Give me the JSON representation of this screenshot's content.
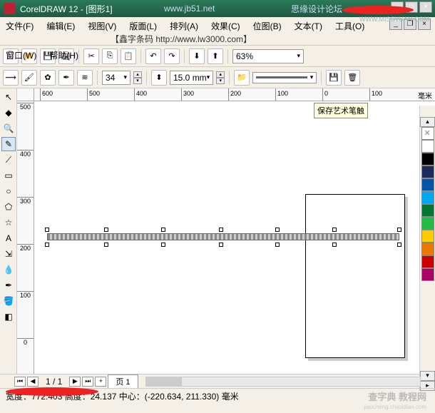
{
  "titlebar": {
    "app": "CorelDRAW 12",
    "doc": "[图形1]",
    "url": "www.jb51.net",
    "forum": "思缘设计论坛",
    "missyuan": "WWW.MISSYUAN.COM"
  },
  "menu": {
    "file": "文件(F)",
    "edit": "编辑(E)",
    "view": "视图(V)",
    "layout": "版面(L)",
    "arrange": "排列(A)",
    "effects": "效果(C)",
    "bitmap": "位图(B)",
    "text": "文本(T)",
    "tools": "工具(O)",
    "window": "窗口(W)",
    "help": "帮助(H)",
    "extra": "【鑫字条码 http://www.lw3000.com】"
  },
  "toolbar": {
    "zoom": "63%"
  },
  "propbar": {
    "preset": "34",
    "width": "15.0 mm"
  },
  "ruler_h": [
    "600",
    "500",
    "400",
    "300",
    "200",
    "100",
    "0",
    "100"
  ],
  "ruler_v": [
    "500",
    "400",
    "300",
    "200",
    "100",
    "0"
  ],
  "unit": "毫米",
  "tooltip": "保存艺术笔触",
  "page_nav": {
    "counter": "1 / 1",
    "tab": "页 1"
  },
  "status": {
    "dims": "宽度：772.403 高度：24.137 中心：(-220.634, 211.330) 毫米"
  },
  "palette_colors": [
    "#ffffff",
    "#000000",
    "#1a2a5a",
    "#0055aa",
    "#00aaee",
    "#007733",
    "#22bb44",
    "#ffcc00",
    "#ee7700",
    "#cc0000",
    "#aa0066"
  ],
  "watermark": {
    "main": "查字典   教程网",
    "sub": "jiaocheng.chazidian.com"
  }
}
